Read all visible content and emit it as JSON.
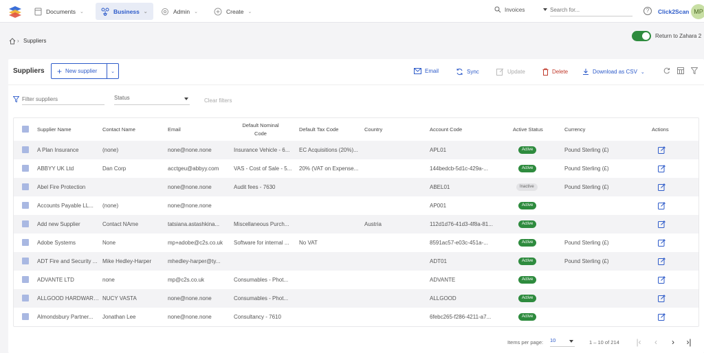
{
  "topbar": {
    "nav": [
      {
        "label": "Documents",
        "icon": "document-icon"
      },
      {
        "label": "Business",
        "icon": "business-icon"
      },
      {
        "label": "Admin",
        "icon": "gear-icon"
      },
      {
        "label": "Create",
        "icon": "plus-circle-icon"
      }
    ],
    "search_scope": "Invoices",
    "search_placeholder": "Search for...",
    "brand": "Click2Scan",
    "avatar_initials": "MP"
  },
  "breadcrumb": {
    "current": "Suppliers"
  },
  "return_toggle": {
    "label": "Return to Zahara 2",
    "on": true
  },
  "page": {
    "title": "Suppliers",
    "new_button": "New supplier",
    "toolbar": {
      "email": "Email",
      "sync": "Sync",
      "update": "Update",
      "delete": "Delete",
      "download": "Download as CSV"
    },
    "filters": {
      "search_placeholder": "Filter suppliers",
      "status_label": "Status",
      "clear": "Clear filters"
    }
  },
  "table": {
    "columns": {
      "supplier_name": "Supplier Name",
      "contact_name": "Contact Name",
      "email": "Email",
      "nominal_code_1": "Default Nominal",
      "nominal_code_2": "Code",
      "tax_code": "Default Tax Code",
      "country": "Country",
      "account_code": "Account Code",
      "active_status": "Active Status",
      "currency": "Currency",
      "actions": "Actions"
    },
    "rows": [
      {
        "name": "A Plan Insurance",
        "contact": "(none)",
        "email": "none@none.none",
        "nominal": "Insurance Vehicle - 6...",
        "tax": "EC Acquisitions (20%)...",
        "country": "",
        "account": "APL01",
        "status": "Active",
        "currency": "Pound Sterling (£)"
      },
      {
        "name": "ABBYY UK Ltd",
        "contact": "Dan Corp",
        "email": "acctgeu@abbyy.com",
        "nominal": "VAS - Cost of Sale - 5...",
        "tax": "20% (VAT on Expense...",
        "country": "",
        "account": "144bedcb-5d1c-429a-...",
        "status": "Active",
        "currency": "Pound Sterling (£)"
      },
      {
        "name": "Abel Fire Protection",
        "contact": "",
        "email": "none@none.none",
        "nominal": "Audit fees - 7630",
        "tax": "",
        "country": "",
        "account": "ABEL01",
        "status": "Inactive",
        "currency": "Pound Sterling (£)"
      },
      {
        "name": "Accounts Payable LL...",
        "contact": "(none)",
        "email": "none@none.none",
        "nominal": "",
        "tax": "",
        "country": "",
        "account": "AP001",
        "status": "Active",
        "currency": ""
      },
      {
        "name": "Add new Supplier",
        "contact": "Contact NAme",
        "email": "tatsiana.astashkina...",
        "nominal": "Miscellaneous Purch...",
        "tax": "",
        "country": "Austria",
        "account": "112d1d76-41d3-4f8a-81...",
        "status": "Active",
        "currency": ""
      },
      {
        "name": "Adobe Systems",
        "contact": "None",
        "email": "mp+adobe@c2s.co.uk",
        "nominal": "Software for internal ...",
        "tax": "No VAT",
        "country": "",
        "account": "8591ac57-e03c-451a-...",
        "status": "Active",
        "currency": "Pound Sterling (£)"
      },
      {
        "name": "ADT Fire and Security ...",
        "contact": "Mike Hedley-Harper",
        "email": "mhedley-harper@ty...",
        "nominal": "",
        "tax": "",
        "country": "",
        "account": "ADT01",
        "status": "Active",
        "currency": "Pound Sterling (£)"
      },
      {
        "name": "ADVANTE LTD",
        "contact": "none",
        "email": "mp@c2s.co.uk",
        "nominal": "Consumables - Phot...",
        "tax": "",
        "country": "",
        "account": "ADVANTE",
        "status": "Active",
        "currency": ""
      },
      {
        "name": "ALLGOOD HARDWARE ...",
        "contact": "NUCY VASTA",
        "email": "none@none.none",
        "nominal": "Consumables - Phot...",
        "tax": "",
        "country": "",
        "account": "ALLGOOD",
        "status": "Active",
        "currency": ""
      },
      {
        "name": "Almondsbury Partner...",
        "contact": "Jonathan Lee",
        "email": "none@none.none",
        "nominal": "Consultancy - 7610",
        "tax": "",
        "country": "",
        "account": "6febc265-f286-4211-a7...",
        "status": "Active",
        "currency": ""
      }
    ]
  },
  "pagination": {
    "items_per_page_label": "Items per page:",
    "items_per_page": "10",
    "range": "1 – 10 of 214"
  },
  "colors": {
    "accent": "#2c5ac9",
    "active": "#2e8b3e",
    "danger": "#c0392b"
  }
}
